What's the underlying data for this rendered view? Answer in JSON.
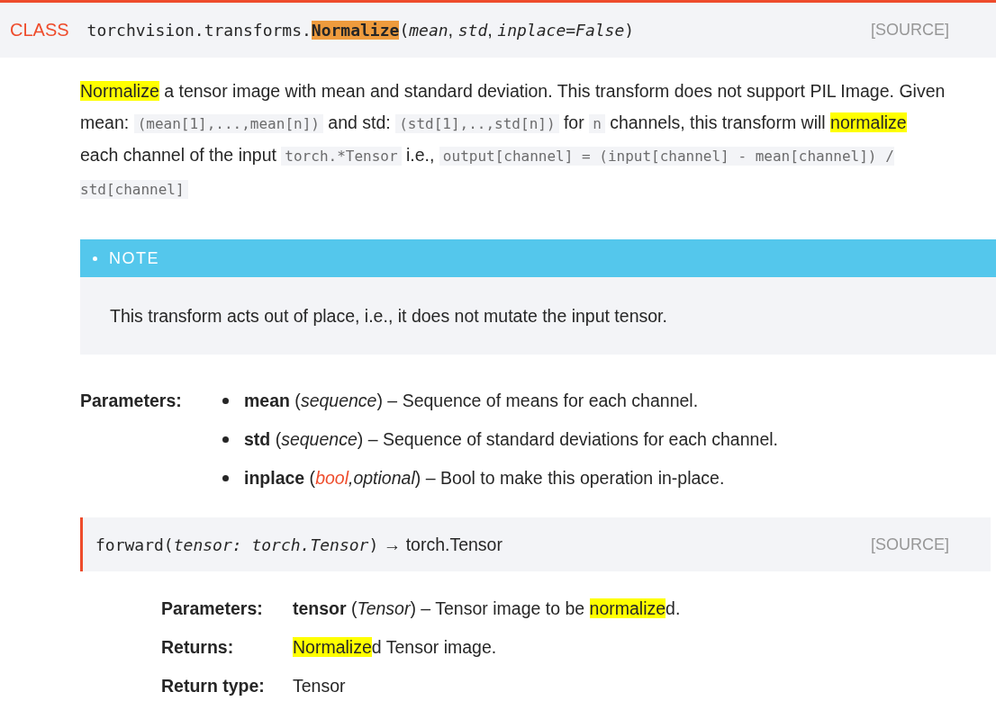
{
  "class_header": {
    "label": "CLASS",
    "signature": [
      {
        "kind": "mono",
        "text": "torchvision.transforms."
      },
      {
        "kind": "mono-hl",
        "text": "Normalize"
      },
      {
        "kind": "mono",
        "text": "("
      },
      {
        "kind": "italic-mono",
        "text": "mean"
      },
      {
        "kind": "text",
        "text": ", "
      },
      {
        "kind": "italic-mono",
        "text": "std"
      },
      {
        "kind": "text",
        "text": ", "
      },
      {
        "kind": "italic-mono",
        "text": "inplace=False"
      },
      {
        "kind": "mono",
        "text": ")"
      }
    ],
    "source_link": "[SOURCE]"
  },
  "description": [
    {
      "kind": "hl",
      "text": "Normalize"
    },
    {
      "kind": "text",
      "text": " a tensor image with mean and standard deviation. This transform does not support PIL Image. Given mean: "
    },
    {
      "kind": "code",
      "text": "(mean[1],...,mean[n])"
    },
    {
      "kind": "text",
      "text": " and std: "
    },
    {
      "kind": "code",
      "text": "(std[1],..,std[n])"
    },
    {
      "kind": "text",
      "text": " for "
    },
    {
      "kind": "code",
      "text": "n"
    },
    {
      "kind": "text",
      "text": " channels, this transform will "
    },
    {
      "kind": "hl",
      "text": "normalize"
    },
    {
      "kind": "text",
      "text": " each channel of the input "
    },
    {
      "kind": "code",
      "text": "torch.*Tensor"
    },
    {
      "kind": "text",
      "text": " i.e., "
    },
    {
      "kind": "code",
      "text": "output[channel] = (input[channel] - mean[channel]) / std[channel]"
    }
  ],
  "note": {
    "title": "NOTE",
    "text": "This transform acts out of place, i.e., it does not mutate the input tensor."
  },
  "parameters": {
    "label": "Parameters:",
    "items": [
      [
        {
          "kind": "bold",
          "text": "mean"
        },
        {
          "kind": "text",
          "text": " ("
        },
        {
          "kind": "italic",
          "text": "sequence"
        },
        {
          "kind": "text",
          "text": ") – Sequence of means for each channel."
        }
      ],
      [
        {
          "kind": "bold",
          "text": "std"
        },
        {
          "kind": "text",
          "text": " ("
        },
        {
          "kind": "italic",
          "text": "sequence"
        },
        {
          "kind": "text",
          "text": ") – Sequence of standard deviations for each channel."
        }
      ],
      [
        {
          "kind": "bold",
          "text": "inplace"
        },
        {
          "kind": "text",
          "text": " ("
        },
        {
          "kind": "italic-link",
          "text": "bool"
        },
        {
          "kind": "italic",
          "text": ",optional"
        },
        {
          "kind": "text",
          "text": ") – Bool to make this operation in-place."
        }
      ]
    ]
  },
  "method": {
    "signature": [
      {
        "kind": "mono",
        "text": "forward("
      },
      {
        "kind": "italic-mono",
        "text": "tensor: torch.Tensor"
      },
      {
        "kind": "mono",
        "text": ")"
      },
      {
        "kind": "text",
        "text": " → torch.Tensor"
      }
    ],
    "source_link": "[SOURCE]",
    "fields": [
      {
        "label": "Parameters:",
        "value": [
          {
            "kind": "bold",
            "text": "tensor"
          },
          {
            "kind": "text",
            "text": " ("
          },
          {
            "kind": "italic",
            "text": "Tensor"
          },
          {
            "kind": "text",
            "text": ") – Tensor image to be "
          },
          {
            "kind": "hl",
            "text": "normalize"
          },
          {
            "kind": "text",
            "text": "d."
          }
        ]
      },
      {
        "label": "Returns:",
        "value": [
          {
            "kind": "hl",
            "text": "Normalize"
          },
          {
            "kind": "text",
            "text": "d Tensor image."
          }
        ]
      },
      {
        "label": "Return type:",
        "value": [
          {
            "kind": "text",
            "text": "Tensor"
          }
        ]
      }
    ]
  }
}
